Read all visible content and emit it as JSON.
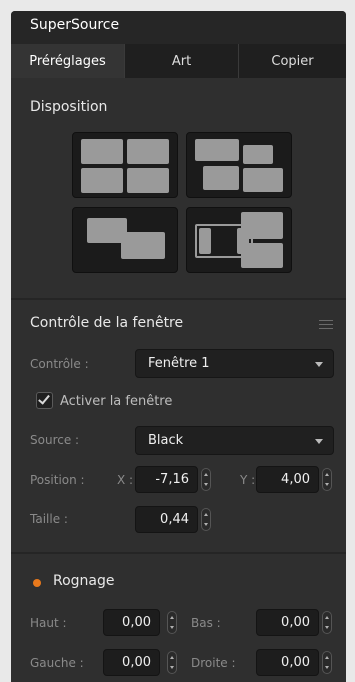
{
  "window": {
    "title": "SuperSource"
  },
  "tabs": [
    {
      "label": "Préréglages",
      "active": true
    },
    {
      "label": "Art",
      "active": false
    },
    {
      "label": "Copier",
      "active": false
    }
  ],
  "disposition": {
    "title": "Disposition",
    "layouts": [
      "quad-layout",
      "offset-layout",
      "pip-layout",
      "split-layout"
    ]
  },
  "window_control": {
    "title": "Contrôle de la fenêtre",
    "control_label": "Contrôle :",
    "control_value": "Fenêtre 1",
    "enable_label": "Activer la fenêtre",
    "enable_checked": true,
    "source_label": "Source :",
    "source_value": "Black",
    "position_label": "Position :",
    "x_label": "X :",
    "x_value": "-7,16",
    "y_label": "Y :",
    "y_value": "4,00",
    "size_label": "Taille :",
    "size_value": "0,44"
  },
  "crop": {
    "title": "Rognage",
    "indicator_color": "#e8791c",
    "top_label": "Haut :",
    "top_value": "0,00",
    "bottom_label": "Bas :",
    "bottom_value": "0,00",
    "left_label": "Gauche :",
    "left_value": "0,00",
    "right_label": "Droite :",
    "right_value": "0,00"
  },
  "colors": {
    "panel": "#2f2f2f",
    "field": "#1d1d1d",
    "accent": "#e8791c"
  }
}
